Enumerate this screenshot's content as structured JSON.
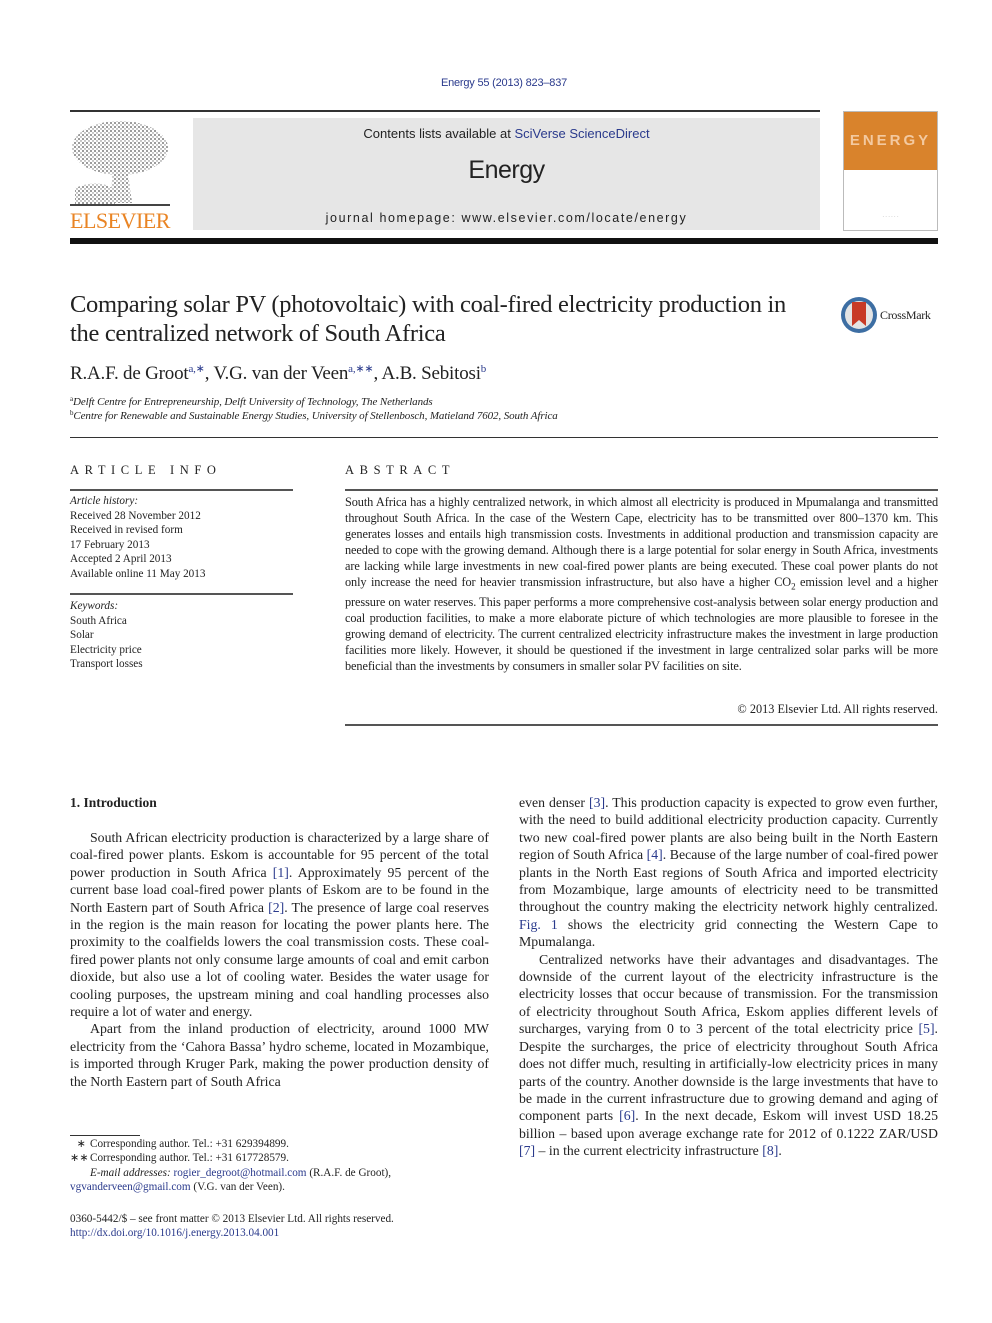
{
  "journal_ref": "Energy 55 (2013) 823–837",
  "header": {
    "publisher_logo_text": "ELSEVIER",
    "contents_prefix": "Contents lists available at ",
    "contents_link": "SciVerse ScienceDirect",
    "journal_name": "Energy",
    "homepage": "journal homepage: www.elsevier.com/locate/energy",
    "cover_title": "ENERGY",
    "brand_orange": "#e98424"
  },
  "article": {
    "title": "Comparing solar PV (photovoltaic) with coal-fired electricity production in the centralized network of South Africa",
    "crossmark_label": "CrossMark",
    "authors": [
      {
        "name": "R.A.F. de Groot",
        "sup": "a,∗"
      },
      {
        "name": "V.G. van der Veen",
        "sup": "a,∗∗"
      },
      {
        "name": "A.B. Sebitosi",
        "sup": "b"
      }
    ],
    "affiliations": [
      {
        "mark": "a",
        "text": "Delft Centre for Entrepreneurship, Delft University of Technology, The Netherlands"
      },
      {
        "mark": "b",
        "text": "Centre for Renewable and Sustainable Energy Studies, University of Stellenbosch, Matieland 7602, South Africa"
      }
    ]
  },
  "article_info": {
    "label": "ARTICLE INFO",
    "history_heading": "Article history:",
    "history": [
      "Received 28 November 2012",
      "Received in revised form",
      "17 February 2013",
      "Accepted 2 April 2013",
      "Available online 11 May 2013"
    ],
    "keywords_heading": "Keywords:",
    "keywords": [
      "South Africa",
      "Solar",
      "Electricity price",
      "Transport losses"
    ]
  },
  "abstract": {
    "label": "ABSTRACT",
    "text_before_co2": "South Africa has a highly centralized network, in which almost all electricity is produced in Mpumalanga and transmitted throughout South Africa. In the case of the Western Cape, electricity has to be transmitted over 800–1370 km. This generates losses and entails high transmission costs. Investments in additional production and transmission capacity are needed to cope with the growing demand. Although there is a large potential for solar energy in South Africa, investments are lacking while large investments in new coal-fired power plants are being executed. These coal power plants do not only increase the need for heavier transmission infrastructure, but also have a higher ",
    "co2": "CO",
    "co2_sub": "2",
    "text_after_co2": " emission level and a higher pressure on water reserves. This paper performs a more comprehensive cost-analysis between solar energy production and coal production facilities, to make a more elaborate picture of which technologies are more plausible to foresee in the growing demand of electricity. The current centralized electricity infrastructure makes the investment in large production facilities more likely. However, it should be questioned if the investment in large centralized solar parks will be more beneficial than the investments by consumers in smaller solar PV facilities on site.",
    "copyright": "© 2013 Elsevier Ltd. All rights reserved."
  },
  "intro": {
    "heading": "1.  Introduction",
    "p1": [
      {
        "t": "South African electricity production is characterized by a large share of coal-fired power plants. Eskom is accountable for 95 percent of the total power production in South Africa "
      },
      {
        "ref": "[1]"
      },
      {
        "t": ". Approximately 95 percent of the current base load coal-fired power plants of Eskom are to be found in the North Eastern part of South Africa "
      },
      {
        "ref": "[2]"
      },
      {
        "t": ". The presence of large coal reserves in the region is the main reason for locating the power plants here. The proximity to the coalfields lowers the coal transmission costs. These coal-fired power plants not only consume large amounts of coal and emit carbon dioxide, but also use a lot of cooling water. Besides the water usage for cooling purposes, the upstream mining and coal handling processes also require a lot of water and energy."
      }
    ],
    "p2": [
      {
        "t": "Apart from the inland production of electricity, around 1000 MW electricity from the ‘Cahora Bassa’ hydro scheme, located in Mozambique, is imported through Kruger Park, making the power production density of the North Eastern part of South Africa "
      }
    ],
    "p2_cont": [
      {
        "t": "even denser "
      },
      {
        "ref": "[3]"
      },
      {
        "t": ". This production capacity is expected to grow even further, with the need to build additional electricity production capacity. Currently two new coal-fired power plants are also being built in the North Eastern region of South Africa "
      },
      {
        "ref": "[4]"
      },
      {
        "t": ". Because of the large number of coal-fired power plants in the North East regions of South Africa and imported electricity from Mozambique, large amounts of electricity need to be transmitted throughout the country making the electricity network highly centralized. "
      },
      {
        "ref": "Fig. 1"
      },
      {
        "t": " shows the electricity grid connecting the Western Cape to Mpumalanga."
      }
    ],
    "p3": [
      {
        "t": "Centralized networks have their advantages and disadvantages. The downside of the current layout of the electricity infrastructure is the electricity losses that occur because of transmission. For the transmission of electricity throughout South Africa, Eskom applies different levels of surcharges, varying from 0 to 3 percent of the total electricity price "
      },
      {
        "ref": "[5]"
      },
      {
        "t": ". Despite the surcharges, the price of electricity throughout South Africa does not differ much, resulting in artificially-low electricity prices in many parts of the country. Another downside is the large investments that have to be made in the current infrastructure due to growing demand and aging of component parts "
      },
      {
        "ref": "[6]"
      },
      {
        "t": ". In the next decade, Eskom will invest USD 18.25 billion – based upon average exchange rate for 2012 of 0.1222 ZAR/USD "
      },
      {
        "ref": "[7]"
      },
      {
        "t": " – in the current electricity infrastructure "
      },
      {
        "ref": "[8]"
      },
      {
        "t": "."
      }
    ]
  },
  "footnotes": {
    "fn1_mark": "∗",
    "fn1": "Corresponding author. Tel.: +31 629394899.",
    "fn2_mark": "∗∗",
    "fn2": "Corresponding author. Tel.: +31 617728579.",
    "email_label": "E-mail addresses:",
    "email1": "rogier_degroot@hotmail.com",
    "email1_owner": " (R.A.F. de Groot), ",
    "email2": "vgvanderveen@gmail.com",
    "email2_owner": " (V.G. van der Veen)."
  },
  "bottom": {
    "issn_line": "0360-5442/$ – see front matter © 2013 Elsevier Ltd. All rights reserved.",
    "doi": "http://dx.doi.org/10.1016/j.energy.2013.04.001"
  }
}
